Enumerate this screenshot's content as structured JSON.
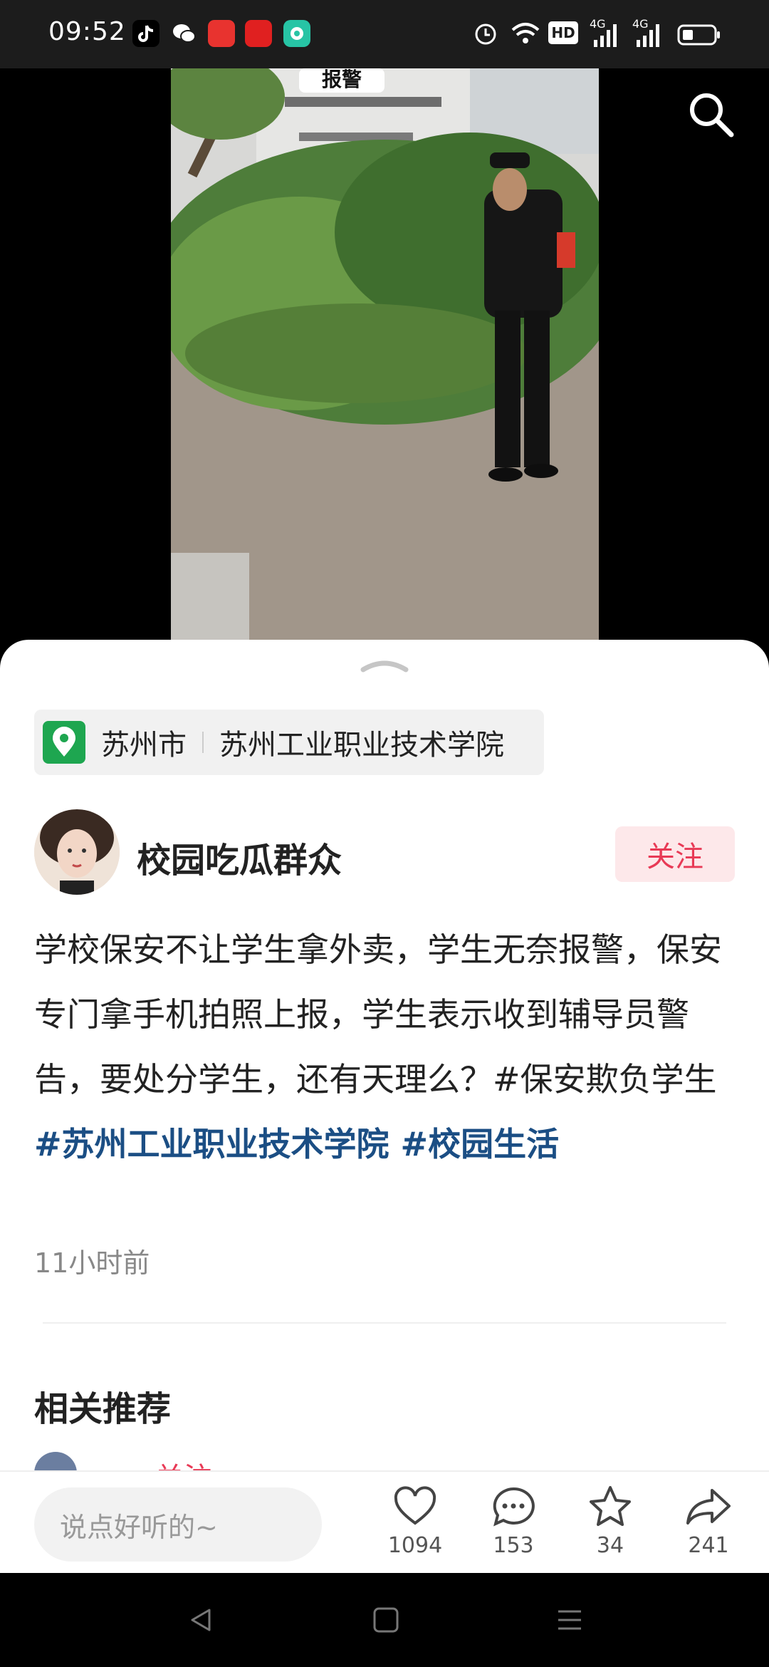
{
  "status_bar": {
    "time": "09:52",
    "hd_label": "HD",
    "net_1": "4G",
    "net_2": "4G",
    "app_icons": [
      "tiktok-icon",
      "wechat-icon",
      "toutiao-icon",
      "news-icon",
      "music-icon"
    ]
  },
  "video": {
    "overlay_text": "报警",
    "search_icon": "search-icon"
  },
  "post": {
    "location_city": "苏州市",
    "location_place": "苏州工业职业技术学院",
    "author_name": "校园吃瓜群众",
    "follow_label": "关注",
    "text_plain": "学校保安不让学生拿外卖，学生无奈报警，保安专门拿手机拍照上报，学生表示收到辅导员警告，要处分学生，还有天理么？#保安欺负学生 ",
    "tag_1": "#苏州工业职业技术学院",
    "tag_2": " #校园生活",
    "time_ago": "11小时前"
  },
  "related": {
    "title": "相关推荐",
    "peek_follow": "关注"
  },
  "bottom_bar": {
    "comment_placeholder": "说点好听的~",
    "like_count": "1094",
    "comment_count": "153",
    "favorite_count": "34",
    "share_count": "241"
  },
  "colors": {
    "accent": "#e83a56",
    "hashtag": "#1b4e84",
    "location_pin": "#1ea650"
  }
}
